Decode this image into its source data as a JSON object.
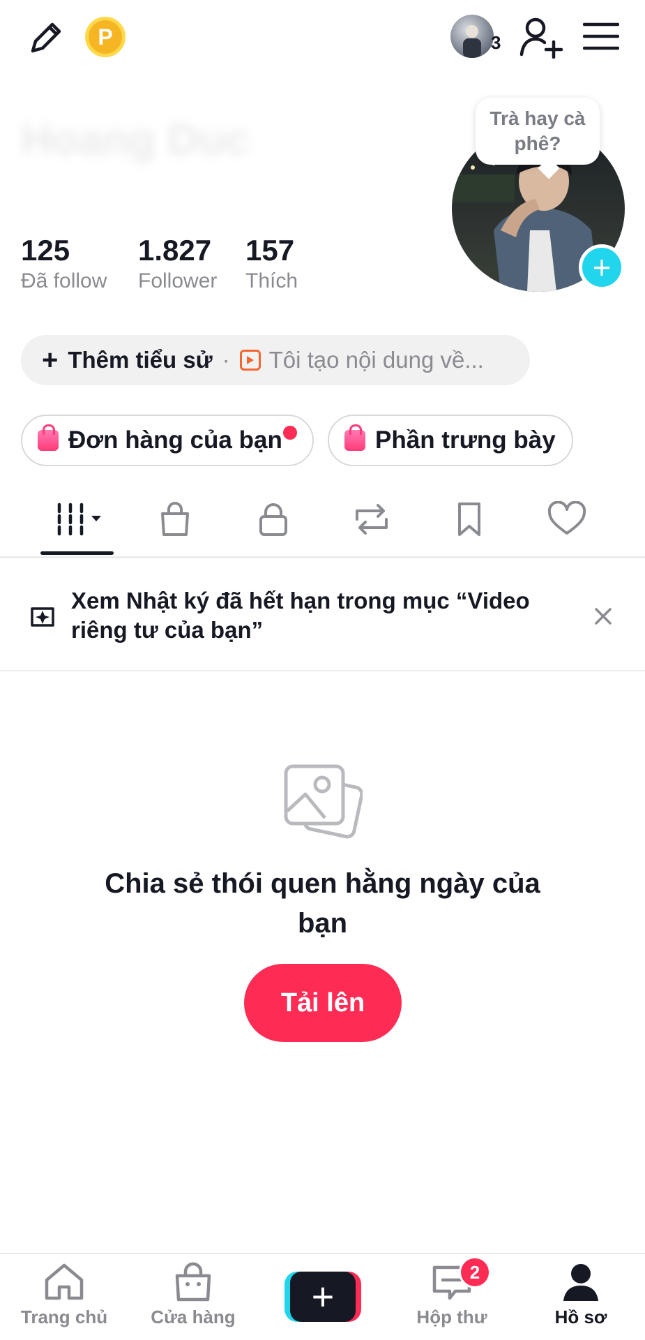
{
  "header": {
    "coin_letter": "P",
    "following_story_count": "3",
    "blurred_name": "Hoang Duc"
  },
  "stats": [
    {
      "value": "125",
      "label": "Đã follow"
    },
    {
      "value": "1.827",
      "label": "Follower"
    },
    {
      "value": "157",
      "label": "Thích"
    }
  ],
  "avatar": {
    "bubble_text": "Trà hay cà phê?"
  },
  "bio": {
    "add_label": "Thêm tiểu sử",
    "separator": "·",
    "hint": "Tôi tạo nội dung về..."
  },
  "shop": {
    "orders_label": "Đơn hàng của bạn",
    "showcase_label": "Phần trưng bày"
  },
  "tabs": [
    "videos",
    "shop",
    "private",
    "reposts",
    "saved",
    "liked"
  ],
  "banner": {
    "text": "Xem Nhật ký đã hết hạn trong mục “Video riêng tư của bạn”"
  },
  "empty_state": {
    "title": "Chia sẻ thói quen hằng ngày của bạn",
    "button": "Tải lên"
  },
  "nav": {
    "home": "Trang chủ",
    "shop": "Cửa hàng",
    "inbox": "Hộp thư",
    "inbox_badge": "2",
    "profile": "Hồ sơ"
  },
  "colors": {
    "accent": "#fe2c55",
    "cyan": "#20d5ec",
    "text": "#161823",
    "muted": "#8a8b91"
  }
}
